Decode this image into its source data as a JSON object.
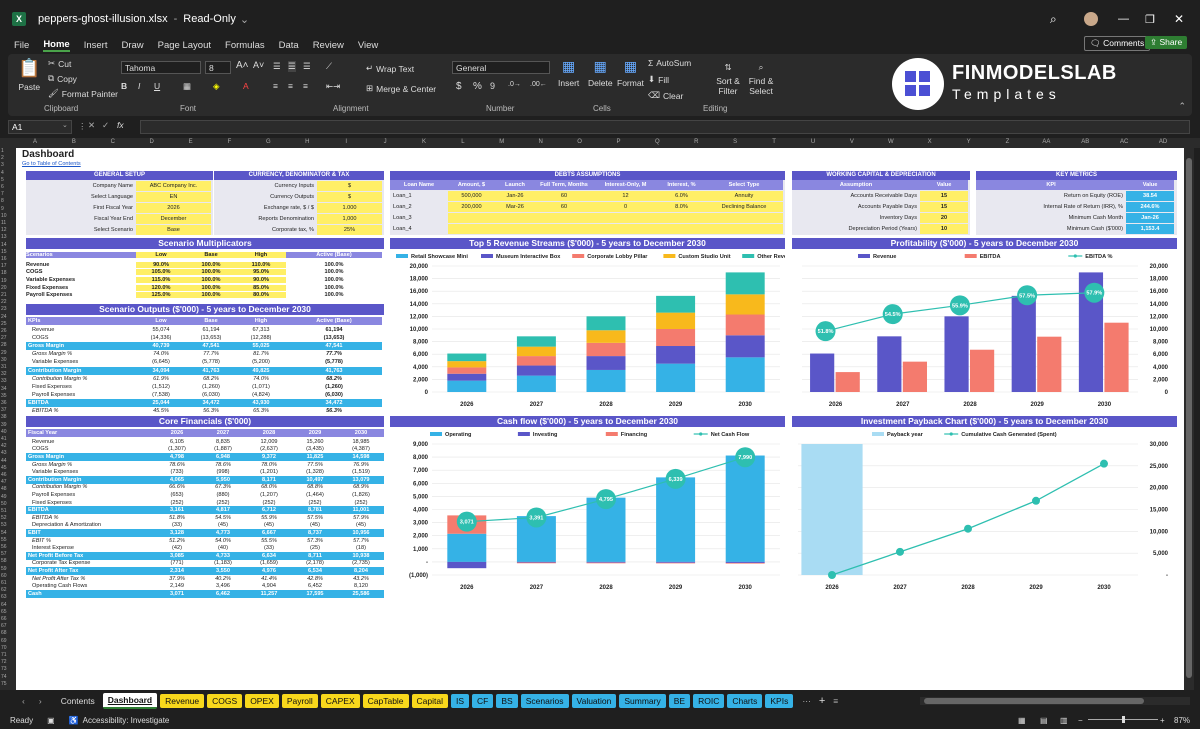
{
  "titlebar": {
    "filename": "peppers-ghost-illusion.xlsx",
    "mode": "Read-Only"
  },
  "menu": [
    "File",
    "Home",
    "Insert",
    "Draw",
    "Page Layout",
    "Formulas",
    "Data",
    "Review",
    "View"
  ],
  "menu_right": {
    "comments": "Comments",
    "share": "Share"
  },
  "ribbon": {
    "paste": "Paste",
    "cut": "Cut",
    "copy": "Copy",
    "format_painter": "Format Painter",
    "clipboard": "Clipboard",
    "font_name": "Tahoma",
    "font_size": "8",
    "font": "Font",
    "wrap": "Wrap Text",
    "merge": "Merge & Center",
    "alignment": "Alignment",
    "number_format": "General",
    "number": "Number",
    "insert": "Insert",
    "delete": "Delete",
    "format": "Format",
    "cells": "Cells",
    "autosum": "AutoSum",
    "fill": "Fill",
    "clear": "Clear",
    "sort": "Sort & Filter",
    "find": "Find & Select",
    "editing": "Editing",
    "logo_top": "FINMODELSLAB",
    "logo_bottom": "Templates"
  },
  "formula": {
    "cell_ref": "A1",
    "fx": "fx"
  },
  "columns": [
    "A",
    "B",
    "C",
    "D",
    "E",
    "F",
    "G",
    "H",
    "I",
    "J",
    "K",
    "L",
    "M",
    "N",
    "O",
    "P",
    "Q",
    "R",
    "S",
    "T",
    "U",
    "V",
    "W",
    "X",
    "Y",
    "Z",
    "AA",
    "AB",
    "AC",
    "AD"
  ],
  "sheet": {
    "title": "Dashboard",
    "toc": "Go to Table of Contents",
    "general": {
      "title": "GENERAL SETUP",
      "rows": [
        [
          "Company Name",
          "ABC Company Inc."
        ],
        [
          "Select Language",
          "EN"
        ],
        [
          "First Fiscal Year",
          "2026"
        ],
        [
          "Fiscal Year End",
          "December"
        ],
        [
          "Select Scenario",
          "Base"
        ]
      ]
    },
    "currency": {
      "title": "CURRENCY, DENOMINATOR & TAX",
      "rows": [
        [
          "Currency Inputs",
          "$"
        ],
        [
          "Currency Outputs",
          "$"
        ],
        [
          "Exchange rate, $ / $",
          "1.000"
        ],
        [
          "Reports Denomination",
          "1,000"
        ],
        [
          "Corporate tax, %",
          "25%"
        ]
      ]
    },
    "debts": {
      "title": "DEBTS ASSUMPTIONS",
      "headers": [
        "Loan Name",
        "Amount, $",
        "Launch",
        "Full Term, Months",
        "Interest-Only, M",
        "Interest, %",
        "Select Type"
      ],
      "rows": [
        [
          "Loan_1",
          "500,000",
          "Jan-26",
          "60",
          "12",
          "6.0%",
          "Annuity"
        ],
        [
          "Loan_2",
          "200,000",
          "Mar-26",
          "60",
          "0",
          "8.0%",
          "Declining Balance"
        ],
        [
          "Loan_3",
          "",
          "",
          "",
          "",
          "",
          ""
        ],
        [
          "Loan_4",
          "",
          "",
          "",
          "",
          "",
          ""
        ]
      ]
    },
    "wc": {
      "title": "WORKING CAPITAL & DEPRECIATION",
      "headers": [
        "Assumption",
        "Value"
      ],
      "rows": [
        [
          "Accounts Receivable Days",
          "15"
        ],
        [
          "Accounts Payable Days",
          "15"
        ],
        [
          "Inventory Days",
          "20"
        ],
        [
          "Depreciation Period (Years)",
          "10"
        ]
      ]
    },
    "kpi": {
      "title": "KEY METRICS",
      "headers": [
        "KPI",
        "Value"
      ],
      "rows": [
        [
          "Return on Equity (ROE)",
          "38.54"
        ],
        [
          "Internal Rate of Return (IRR), %",
          "244.6%"
        ],
        [
          "Minimum Cash Month",
          "Jan-26"
        ],
        [
          "Minimum Cash ($'000)",
          "1,153.4"
        ]
      ]
    },
    "multipliers": {
      "title": "Scenario Multiplicators",
      "headers": [
        "Scenarios",
        "Low",
        "Base",
        "High",
        "Active (Base)"
      ],
      "rows": [
        [
          "Revenue",
          "90.0%",
          "100.0%",
          "110.0%",
          "100.0%"
        ],
        [
          "COGS",
          "105.0%",
          "100.0%",
          "95.0%",
          "100.0%"
        ],
        [
          "Variable Expenses",
          "115.0%",
          "100.0%",
          "90.0%",
          "100.0%"
        ],
        [
          "Fixed Expenses",
          "120.0%",
          "100.0%",
          "85.0%",
          "100.0%"
        ],
        [
          "Payroll Expenses",
          "125.0%",
          "100.0%",
          "80.0%",
          "100.0%"
        ]
      ]
    },
    "outputs": {
      "title": "Scenario Outputs ($'000) - 5 years to December 2030",
      "headers": [
        "KPIs",
        "Low",
        "Base",
        "High",
        "Active (Base)"
      ],
      "rows": [
        [
          "Revenue",
          "55,074",
          "61,194",
          "67,313",
          "61,194",
          ""
        ],
        [
          "COGS",
          "(14,336)",
          "(13,653)",
          "(12,288)",
          "(13,653)",
          ""
        ],
        [
          "Gross Margin",
          "40,739",
          "47,541",
          "55,025",
          "47,541",
          "b"
        ],
        [
          "Gross Margin %",
          "74.0%",
          "77.7%",
          "81.7%",
          "77.7%",
          "i"
        ],
        [
          "Variable Expenses",
          "(6,645)",
          "(5,778)",
          "(5,200)",
          "(5,778)",
          ""
        ],
        [
          "Contribution Margin",
          "34,094",
          "41,763",
          "49,825",
          "41,763",
          "b"
        ],
        [
          "Contribution Margin %",
          "61.9%",
          "68.2%",
          "74.0%",
          "68.2%",
          "i"
        ],
        [
          "Fixed Expenses",
          "(1,512)",
          "(1,260)",
          "(1,071)",
          "(1,260)",
          ""
        ],
        [
          "Payroll Expenses",
          "(7,538)",
          "(6,030)",
          "(4,824)",
          "(6,030)",
          ""
        ],
        [
          "EBITDA",
          "25,044",
          "34,472",
          "43,930",
          "34,472",
          "b"
        ],
        [
          "EBITDA %",
          "45.5%",
          "56.3%",
          "65.3%",
          "56.3%",
          "i"
        ]
      ]
    },
    "core": {
      "title": "Core Financials ($'000)",
      "headers": [
        "Fiscal Year",
        "2026",
        "2027",
        "2028",
        "2029",
        "2030"
      ],
      "rows": [
        [
          "Revenue",
          "6,105",
          "8,835",
          "12,009",
          "15,260",
          "18,985",
          ""
        ],
        [
          "COGS",
          "(1,307)",
          "(1,887)",
          "(2,637)",
          "(3,435)",
          "(4,387)",
          ""
        ],
        [
          "Gross Margin",
          "4,798",
          "6,948",
          "9,372",
          "11,825",
          "14,598",
          "b"
        ],
        [
          "Gross Margin %",
          "78.6%",
          "78.6%",
          "78.0%",
          "77.5%",
          "76.9%",
          "i"
        ],
        [
          "Variable Expenses",
          "(733)",
          "(998)",
          "(1,201)",
          "(1,328)",
          "(1,519)",
          ""
        ],
        [
          "Contribution Margin",
          "4,065",
          "5,950",
          "8,171",
          "10,497",
          "13,079",
          "b"
        ],
        [
          "Contribution Margin %",
          "66.6%",
          "67.3%",
          "68.0%",
          "68.8%",
          "68.9%",
          "i"
        ],
        [
          "Payroll Expenses",
          "(653)",
          "(880)",
          "(1,207)",
          "(1,464)",
          "(1,826)",
          ""
        ],
        [
          "Fixed Expenses",
          "(252)",
          "(252)",
          "(252)",
          "(252)",
          "(252)",
          ""
        ],
        [
          "EBITDA",
          "3,161",
          "4,817",
          "6,712",
          "8,781",
          "11,001",
          "b"
        ],
        [
          "EBITDA %",
          "51.8%",
          "54.5%",
          "55.9%",
          "57.5%",
          "57.9%",
          "i"
        ],
        [
          "Depreciation & Amortization",
          "(33)",
          "(45)",
          "(45)",
          "(45)",
          "(45)",
          ""
        ],
        [
          "EBIT",
          "3,128",
          "4,773",
          "6,667",
          "8,737",
          "10,956",
          "b"
        ],
        [
          "EBIT %",
          "51.2%",
          "54.0%",
          "55.5%",
          "57.3%",
          "57.7%",
          "i"
        ],
        [
          "Interest Expense",
          "(42)",
          "(40)",
          "(33)",
          "(25)",
          "(18)",
          ""
        ],
        [
          "Net Profit Before Tax",
          "3,085",
          "4,733",
          "6,634",
          "8,711",
          "10,938",
          "b"
        ],
        [
          "Corporate Tax Expense",
          "(771)",
          "(1,183)",
          "(1,659)",
          "(2,178)",
          "(2,735)",
          ""
        ],
        [
          "Net Profit After Tax",
          "2,314",
          "3,550",
          "4,976",
          "6,534",
          "8,204",
          "b"
        ],
        [
          "Net Profit After Tax %",
          "37.9%",
          "40.2%",
          "41.4%",
          "42.8%",
          "43.2%",
          "i"
        ],
        [
          "Operating Cash Flows",
          "2,149",
          "3,496",
          "4,904",
          "6,452",
          "8,120",
          ""
        ],
        [
          "Cash",
          "3,071",
          "6,462",
          "11,257",
          "17,595",
          "25,586",
          "b"
        ]
      ]
    }
  },
  "chart_data": [
    {
      "type": "bar",
      "title": "Top 5 Revenue Streams ($'000) - 5 years to December 2030",
      "categories": [
        "2026",
        "2027",
        "2028",
        "2029",
        "2030"
      ],
      "stacked": true,
      "ylim": [
        0,
        20000
      ],
      "yticks": [
        "0",
        "2,000",
        "4,000",
        "6,000",
        "8,000",
        "10,000",
        "12,000",
        "14,000",
        "16,000",
        "18,000",
        "20,000"
      ],
      "series": [
        {
          "name": "Retail Showcase Mini",
          "color": "#35b2e6",
          "values": [
            1800,
            2600,
            3500,
            4500,
            5500
          ]
        },
        {
          "name": "Museum Interactive Box",
          "color": "#5a56c8",
          "values": [
            1100,
            1600,
            2200,
            2800,
            3500
          ]
        },
        {
          "name": "Corporate Lobby Pillar",
          "color": "#f47b6e",
          "values": [
            1000,
            1500,
            2100,
            2700,
            3300
          ]
        },
        {
          "name": "Custom Studio Unit",
          "color": "#f8b91c",
          "values": [
            1000,
            1500,
            2000,
            2600,
            3200
          ]
        },
        {
          "name": "Other Revenue",
          "color": "#2ebfb0",
          "values": [
            1205,
            1635,
            2209,
            2660,
            3485
          ]
        }
      ],
      "legend": "top"
    },
    {
      "type": "bar",
      "title": "Profitability ($'000) - 5 years to December 2030",
      "categories": [
        "2026",
        "2027",
        "2028",
        "2029",
        "2030"
      ],
      "ylim": [
        0,
        20000
      ],
      "yticks": [
        "0",
        "2,000",
        "4,000",
        "6,000",
        "8,000",
        "10,000",
        "12,000",
        "14,000",
        "16,000",
        "18,000",
        "20,000"
      ],
      "series": [
        {
          "name": "Revenue",
          "color": "#5a56c8",
          "values": [
            6105,
            8835,
            12009,
            15260,
            18985
          ]
        },
        {
          "name": "EBITDA",
          "color": "#f47b6e",
          "values": [
            3161,
            4817,
            6712,
            8781,
            11001
          ]
        }
      ],
      "line": {
        "name": "EBITDA %",
        "color": "#2ebfb0",
        "values": [
          51.8,
          54.5,
          55.9,
          57.5,
          57.9
        ],
        "labels": [
          "51.8%",
          "54.5%",
          "55.9%",
          "57.5%",
          "57.9%"
        ]
      },
      "legend": "top"
    },
    {
      "type": "bar",
      "title": "Cash flow ($'000) - 5 years to December 2030",
      "categories": [
        "2026",
        "2027",
        "2028",
        "2029",
        "2030"
      ],
      "ylim": [
        -1000,
        9000
      ],
      "yticks": [
        "(1,000)",
        "-",
        "1,000",
        "2,000",
        "3,000",
        "4,000",
        "5,000",
        "6,000",
        "7,000",
        "8,000",
        "9,000"
      ],
      "series": [
        {
          "name": "Operating",
          "color": "#35b2e6",
          "values": [
            2149,
            3496,
            4904,
            6452,
            8120
          ]
        },
        {
          "name": "Investing",
          "color": "#5a56c8",
          "values": [
            -480,
            -50,
            -60,
            -70,
            -80
          ]
        },
        {
          "name": "Financing",
          "color": "#f47b6e",
          "values": [
            1402,
            -55,
            -49,
            -44,
            -49
          ]
        }
      ],
      "line": {
        "name": "Net Cash Flow",
        "color": "#2ebfb0",
        "values": [
          3071,
          3391,
          4795,
          6339,
          7990
        ],
        "labels": [
          "3,071",
          "3,391",
          "4,795",
          "6,339",
          "7,990"
        ]
      },
      "legend": "top"
    },
    {
      "type": "line",
      "title": "Investment Payback Chart ($'000) - 5 years to December 2030",
      "categories": [
        "2026",
        "2027",
        "2028",
        "2029",
        "2030"
      ],
      "ylim": [
        0,
        30000
      ],
      "yticks": [
        "-",
        "5,000",
        "10,000",
        "15,000",
        "20,000",
        "25,000",
        "30,000"
      ],
      "series": [
        {
          "name": "Payback year",
          "color": "#a9dcf3",
          "values": [
            30000,
            0,
            0,
            0,
            0
          ]
        },
        {
          "name": "Cumulative Cash Generated (Spent)",
          "color": "#2ebfb0",
          "values": [
            0,
            5300,
            10600,
            17000,
            25500
          ]
        }
      ],
      "legend": "top"
    }
  ],
  "tabs": [
    {
      "label": "Contents",
      "color": "transparent",
      "text": "#ddd"
    },
    {
      "label": "Dashboard",
      "color": "#ffffff",
      "text": "#111",
      "active": true
    },
    {
      "label": "Revenue",
      "color": "#f8d81c"
    },
    {
      "label": "COGS",
      "color": "#f8d81c"
    },
    {
      "label": "OPEX",
      "color": "#f8d81c"
    },
    {
      "label": "Payroll",
      "color": "#f8d81c"
    },
    {
      "label": "CAPEX",
      "color": "#f8d81c"
    },
    {
      "label": "CapTable",
      "color": "#f8d81c"
    },
    {
      "label": "Capital",
      "color": "#f8d81c"
    },
    {
      "label": "IS",
      "color": "#35b2e6"
    },
    {
      "label": "CF",
      "color": "#35b2e6"
    },
    {
      "label": "BS",
      "color": "#35b2e6"
    },
    {
      "label": "Scenarios",
      "color": "#35b2e6"
    },
    {
      "label": "Valuation",
      "color": "#35b2e6"
    },
    {
      "label": "Summary",
      "color": "#35b2e6"
    },
    {
      "label": "BE",
      "color": "#35b2e6"
    },
    {
      "label": "ROIC",
      "color": "#35b2e6"
    },
    {
      "label": "Charts",
      "color": "#35b2e6"
    },
    {
      "label": "KPIs",
      "color": "#35b2e6"
    }
  ],
  "status": {
    "ready": "Ready",
    "accessibility": "Accessibility: Investigate",
    "zoom": "87%"
  }
}
